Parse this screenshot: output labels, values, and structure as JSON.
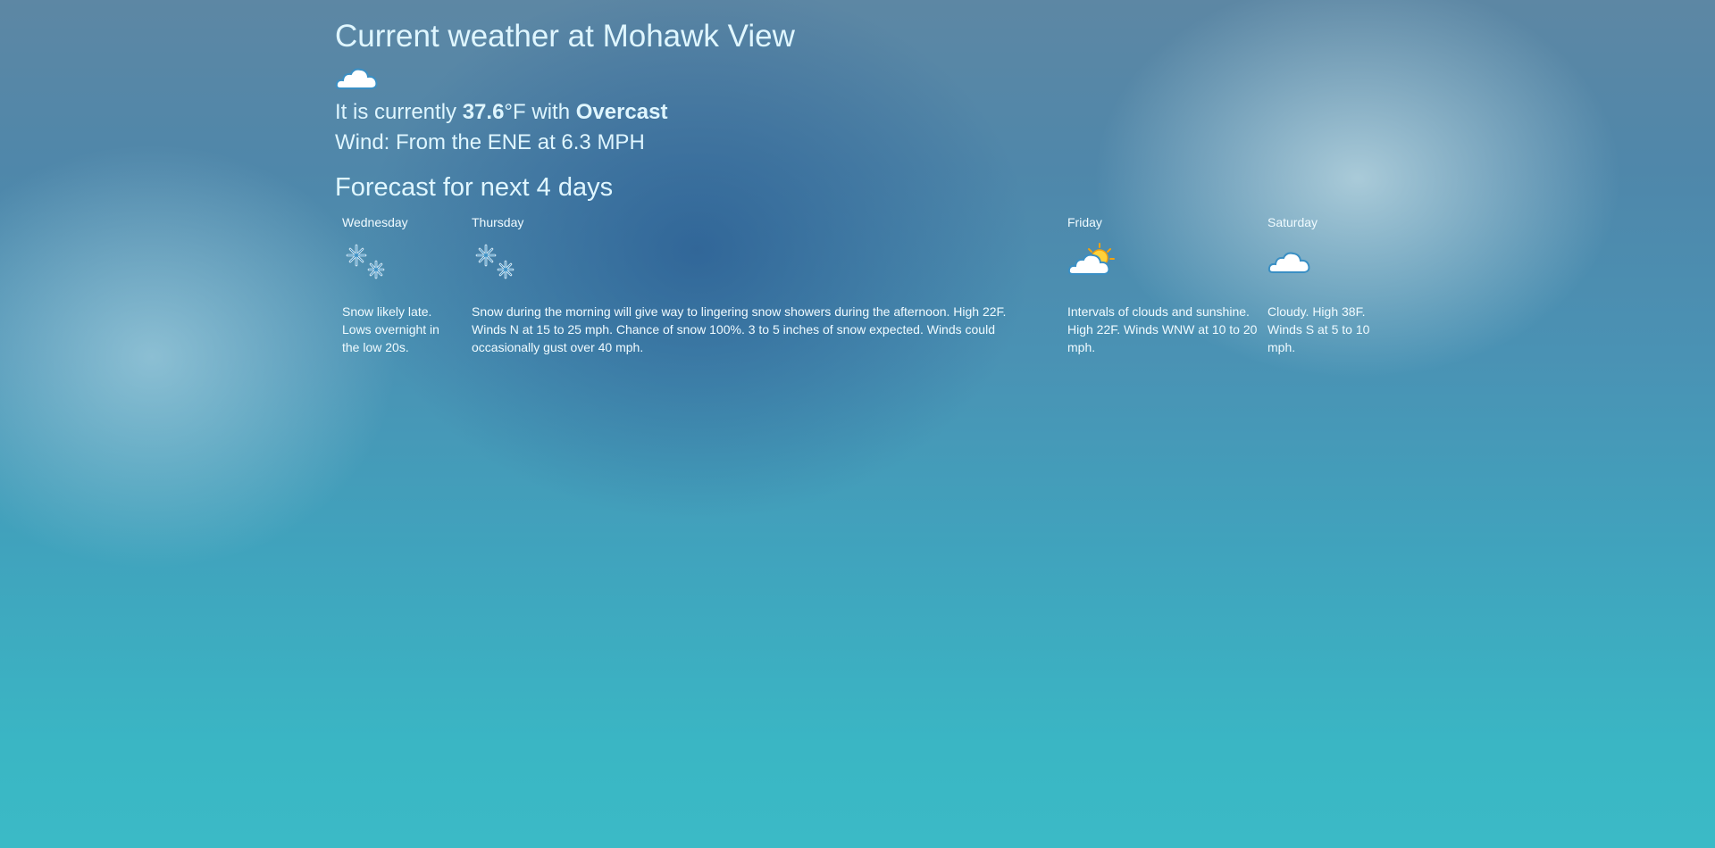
{
  "header": {
    "title": "Current weather at Mohawk View"
  },
  "current": {
    "icon": "cloud-icon",
    "prefix": "It is currently ",
    "temperature": "37.6",
    "unit": "°F",
    "with": " with ",
    "condition": "Overcast",
    "wind": "Wind: From the ENE at 6.3 MPH"
  },
  "forecast": {
    "heading": "Forecast for next 4 days",
    "days": [
      {
        "name": "Wednesday",
        "icon": "snow-icon",
        "description": "Snow likely late. Lows overnight in the low 20s."
      },
      {
        "name": "Thursday",
        "icon": "snow-icon",
        "description": "Snow during the morning will give way to lingering snow showers during the afternoon. High 22F. Winds N at 15 to 25 mph. Chance of snow 100%. 3 to 5 inches of snow expected. Winds could occasionally gust over 40 mph."
      },
      {
        "name": "Friday",
        "icon": "partly-cloudy-icon",
        "description": "Intervals of clouds and sunshine. High 22F. Winds WNW at 10 to 20 mph."
      },
      {
        "name": "Saturday",
        "icon": "cloud-icon",
        "description": "Cloudy. High 38F. Winds S at 5 to 10 mph."
      }
    ]
  }
}
